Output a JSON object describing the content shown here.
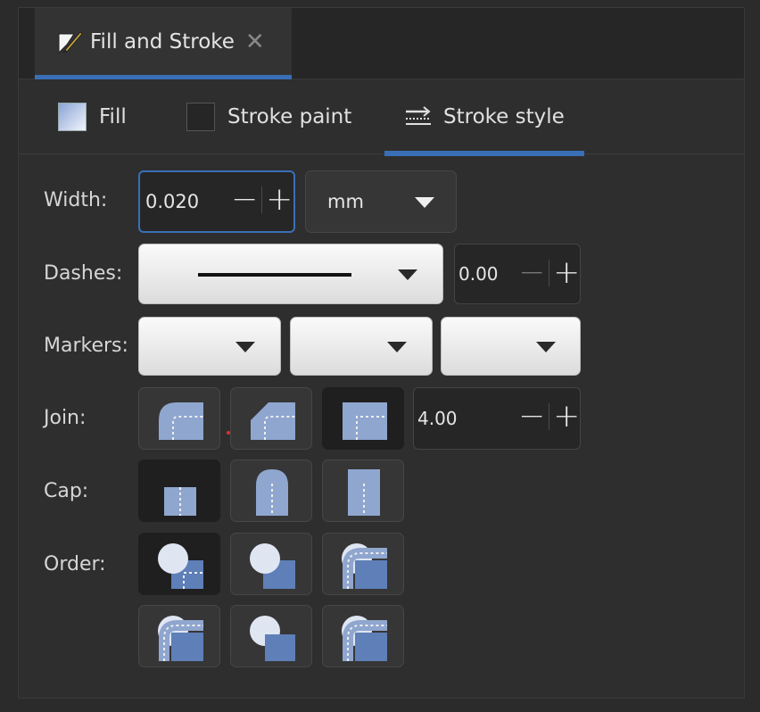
{
  "dock_tab": {
    "title": "Fill and Stroke",
    "icon": "fill-stroke-icon",
    "close_icon": "close-icon"
  },
  "subtabs": [
    {
      "label": "Fill",
      "icon": "fill-swatch-icon"
    },
    {
      "label": "Stroke paint",
      "icon": "stroke-paint-swatch-icon"
    },
    {
      "label": "Stroke style",
      "icon": "stroke-style-icon",
      "active": true
    }
  ],
  "width": {
    "label": "Width:",
    "value": "0.020",
    "unit": "mm"
  },
  "dashes": {
    "label": "Dashes:",
    "offset": "0.00"
  },
  "markers": {
    "label": "Markers:",
    "start": "",
    "mid": "",
    "end": ""
  },
  "join": {
    "label": "Join:",
    "options": [
      "round-join-icon",
      "bevel-join-icon",
      "miter-join-icon"
    ],
    "selected": 2,
    "miter_limit": "4.00"
  },
  "cap": {
    "label": "Cap:",
    "options": [
      "butt-cap-icon",
      "round-cap-icon",
      "square-cap-icon"
    ],
    "selected": 0
  },
  "order": {
    "label": "Order:",
    "options": [
      "order-fill-stroke-markers-icon",
      "order-stroke-fill-markers-icon",
      "order-fill-markers-stroke-icon",
      "order-markers-fill-stroke-icon",
      "order-stroke-markers-fill-icon",
      "order-markers-stroke-fill-icon"
    ],
    "selected": 0
  },
  "colors": {
    "accent": "#3a6fb7",
    "panel": "#2e2e2e",
    "icon_fill": "#8fa6cf"
  }
}
